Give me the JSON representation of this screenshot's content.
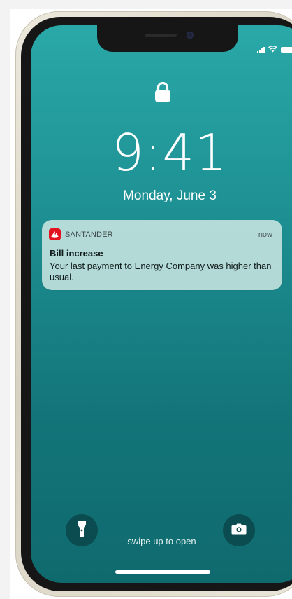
{
  "status_bar": {
    "icons": [
      "signal-icon",
      "wifi-icon",
      "battery-icon"
    ]
  },
  "lock_screen": {
    "lock_icon": "lock-icon",
    "time": "9:41",
    "date": "Monday, June 3"
  },
  "notification": {
    "app_icon": "santander-flame-icon",
    "app_name": "SANTANDER",
    "time": "now",
    "title": "Bill increase",
    "body": "Your last payment to Energy Company was higher than usual."
  },
  "bottom": {
    "flashlight_icon": "flashlight-icon",
    "camera_icon": "camera-icon",
    "swipe_text": "swipe up to open"
  },
  "colors": {
    "wallpaper_top": "#2aa8a8",
    "wallpaper_bottom": "#0f6a6e",
    "brand_red": "#e3121f",
    "phone_frame": "#e6e1d3"
  }
}
